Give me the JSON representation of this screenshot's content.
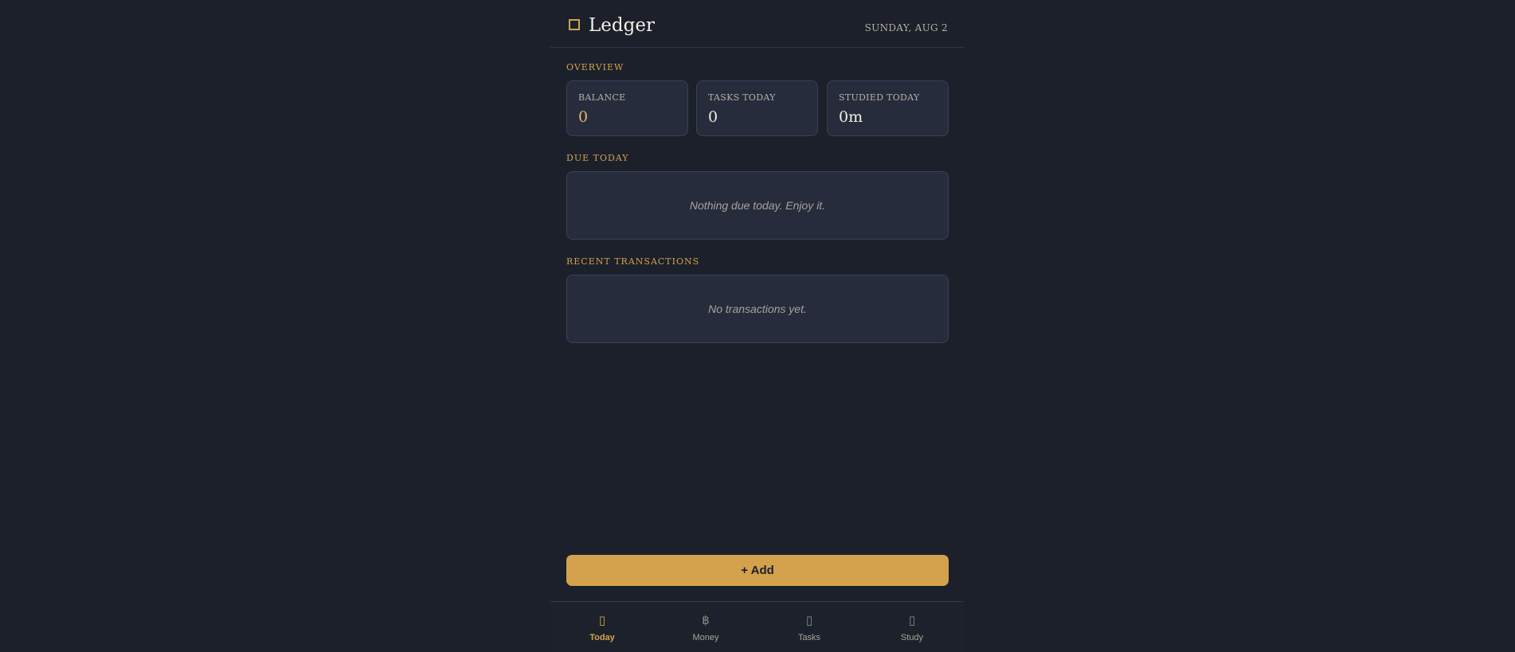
{
  "header": {
    "title": "Ledger",
    "date": "SUNDAY, AUG 2"
  },
  "overview": {
    "label": "OVERVIEW",
    "stats": [
      {
        "label": "BALANCE",
        "value": "0"
      },
      {
        "label": "TASKS TODAY",
        "value": "0"
      },
      {
        "label": "STUDIED TODAY",
        "value": "0m"
      }
    ]
  },
  "due_today": {
    "label": "DUE TODAY",
    "empty_text": "Nothing due today. Enjoy it."
  },
  "recent_transactions": {
    "label": "RECENT TRANSACTIONS",
    "empty_text": "No transactions yet."
  },
  "add_button": {
    "label": "+ Add"
  },
  "nav": {
    "active": "Today",
    "items": [
      {
        "label": "Today",
        "icon": "calendar-icon",
        "glyph": "▯"
      },
      {
        "label": "Money",
        "icon": "currency-icon",
        "glyph": "฿"
      },
      {
        "label": "Tasks",
        "icon": "checklist-icon",
        "glyph": "▯"
      },
      {
        "label": "Study",
        "icon": "book-icon",
        "glyph": "▯"
      }
    ]
  },
  "colors": {
    "accent": "#d4a24c",
    "background": "#1b202b",
    "card": "#262c3c"
  }
}
